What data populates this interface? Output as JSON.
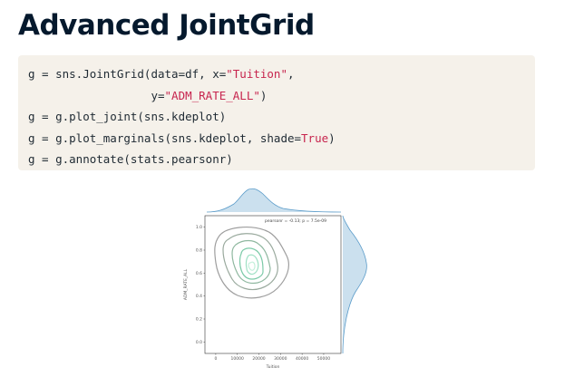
{
  "slide": {
    "title": "Advanced JointGrid"
  },
  "code": {
    "line1_a": "g = sns.JointGrid(data=df, x=",
    "line1_str": "\"Tuition\"",
    "line1_b": ",",
    "line2_a": "                  y=",
    "line2_str": "\"ADM_RATE_ALL\"",
    "line2_b": ")",
    "line3": "g = g.plot_joint(sns.kdeplot)",
    "line4_a": "g = g.plot_marginals(sns.kdeplot, shade=",
    "line4_kw": "True",
    "line4_b": ")",
    "line5": "g = g.annotate(stats.pearsonr)"
  },
  "chart_data": {
    "type": "kde-joint",
    "xlabel": "Tuition",
    "ylabel": "ADM_RATE_ALL",
    "xticks": [
      "0",
      "10000",
      "20000",
      "30000",
      "40000",
      "50000"
    ],
    "yticks": [
      "0.0",
      "0.2",
      "0.4",
      "0.6",
      "0.8",
      "1.0"
    ],
    "xlim": [
      -5000,
      58000
    ],
    "ylim": [
      -0.1,
      1.1
    ],
    "annotation": "pearsonr = -0.13; p = 7.5e-09",
    "marginal_color": "#a9cce3",
    "contour_colors": [
      "#9e9e9e",
      "#8fb8a0",
      "#7ccaa8",
      "#9ee0c4"
    ]
  }
}
